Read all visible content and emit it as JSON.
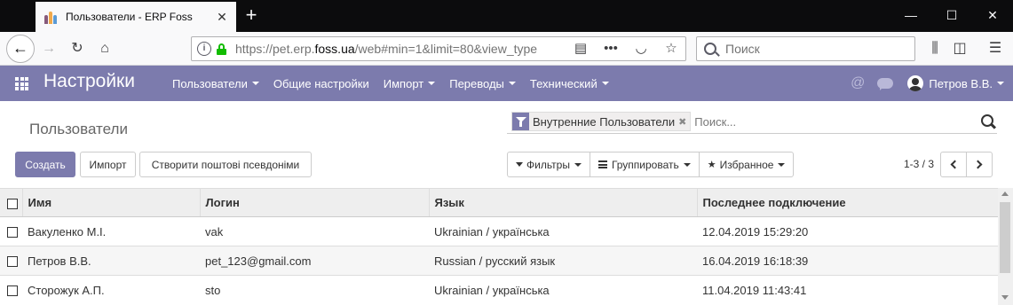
{
  "browser": {
    "tab_title": "Пользователи - ERP Foss",
    "url_prefix": "https://pet.erp.",
    "url_domain": "foss.ua",
    "url_suffix": "/web#min=1&limit=80&view_type",
    "search_placeholder": "Поиск"
  },
  "app": {
    "name": "Настройки",
    "menu": [
      {
        "label": "Пользователи",
        "dropdown": true
      },
      {
        "label": "Общие настройки",
        "dropdown": false
      },
      {
        "label": "Импорт",
        "dropdown": true
      },
      {
        "label": "Переводы",
        "dropdown": true
      },
      {
        "label": "Технический",
        "dropdown": true
      }
    ],
    "user": "Петров В.В."
  },
  "control_panel": {
    "breadcrumb": "Пользователи",
    "facet": "Внутренние Пользователи",
    "search_placeholder": "Поиск...",
    "create_label": "Создать",
    "import_label": "Импорт",
    "alias_label": "Створити поштові псевдоніми",
    "filters_label": "Фильтры",
    "group_label": "Группировать",
    "favorites_label": "Избранное",
    "pager": "1-3 / 3"
  },
  "table": {
    "columns": [
      "Имя",
      "Логин",
      "Язык",
      "Последнее подключение"
    ],
    "rows": [
      {
        "name": "Вакуленко М.І.",
        "login": "vak",
        "lang": "Ukrainian / українська",
        "last": "12.04.2019 15:29:20"
      },
      {
        "name": "Петров В.В.",
        "login": "pet_123@gmail.com",
        "lang": "Russian / русский язык",
        "last": "16.04.2019 16:18:39"
      },
      {
        "name": "Сторожук А.П.",
        "login": "sto",
        "lang": "Ukrainian / українська",
        "last": "11.04.2019 11:43:41"
      }
    ]
  }
}
